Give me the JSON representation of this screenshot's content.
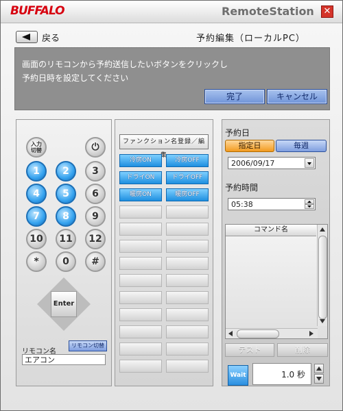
{
  "window": {
    "brand": "BUFFALO",
    "app_title": "RemoteStation",
    "close_glyph": "✕"
  },
  "header": {
    "back_label": "戻る",
    "page_title": "予約編集（ローカルPC）"
  },
  "instructions": {
    "text": "画面のリモコンから予約送信したいボタンをクリックし\n予約日時を設定してください",
    "done_label": "完了",
    "cancel_label": "キャンセル"
  },
  "remote": {
    "power_icon": "⏻",
    "input_switch_label": "入力\n切替",
    "buttons": [
      {
        "label": "1",
        "style": "blue"
      },
      {
        "label": "2",
        "style": "blue"
      },
      {
        "label": "3",
        "style": "gray"
      },
      {
        "label": "4",
        "style": "blue"
      },
      {
        "label": "5",
        "style": "blue"
      },
      {
        "label": "6",
        "style": "gray"
      },
      {
        "label": "7",
        "style": "blue"
      },
      {
        "label": "8",
        "style": "blue"
      },
      {
        "label": "9",
        "style": "gray"
      },
      {
        "label": "10",
        "style": "gray"
      },
      {
        "label": "11",
        "style": "gray"
      },
      {
        "label": "12",
        "style": "gray"
      },
      {
        "label": "*",
        "style": "gray"
      },
      {
        "label": "0",
        "style": "gray"
      },
      {
        "label": "#",
        "style": "gray"
      }
    ],
    "enter_label": "Enter",
    "name_label": "リモコン名",
    "switch_label": "リモコン切替",
    "name_value": "エアコン"
  },
  "functions": {
    "register_label": "ファンクション名登録／編集",
    "slots": [
      "冷房ON",
      "冷房OFF",
      "ドライON",
      "ドライOFF",
      "暖房ON",
      "暖房OFF",
      "",
      "",
      "",
      "",
      "",
      "",
      "",
      "",
      "",
      "",
      "",
      "",
      "",
      "",
      "",
      "",
      "",
      "",
      "",
      "",
      ""
    ]
  },
  "schedule": {
    "date_label": "予約日",
    "mode_specified": "指定日",
    "mode_weekly": "毎週",
    "date_value": "2006/09/17",
    "time_label": "予約時間",
    "time_value": "05:38",
    "command_header": "コマンド名",
    "test_label": "テスト",
    "delete_label": "削除",
    "wait_label": "Wait",
    "wait_value": "1.0 秒"
  },
  "colors": {
    "accent_blue": "#36a3ef",
    "selected_orange": "#f29b1f",
    "brand_red": "#d7000f"
  }
}
